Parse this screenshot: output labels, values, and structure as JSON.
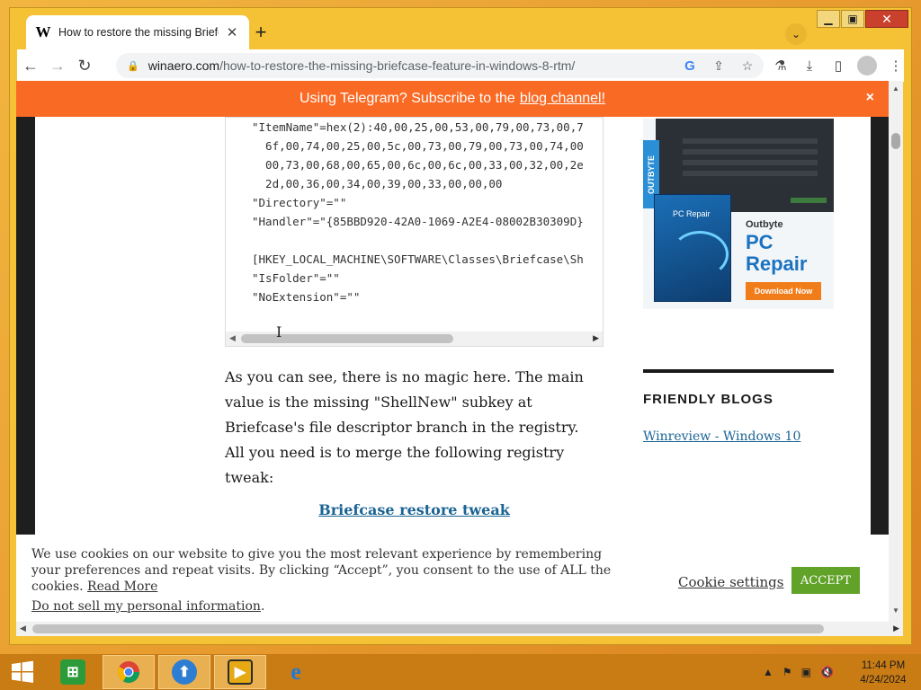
{
  "browser": {
    "tab": {
      "favicon": "W",
      "title": "How to restore the missing Briefc",
      "close": "✕"
    },
    "new_tab": "+",
    "tab_search": "⌄",
    "window_controls": {
      "minimize": "▁",
      "maximize": "▣",
      "close": "✕"
    },
    "nav": {
      "back": "←",
      "forward": "→",
      "reload": "↻"
    },
    "url": {
      "host": "winaero.com",
      "path": "/how-to-restore-the-missing-briefcase-feature-in-windows-8-rtm/"
    },
    "omni_icons": {
      "google": "G",
      "share": "⇪",
      "bookmark": "☆"
    },
    "ext_icons": {
      "lab": "⚗",
      "download": "⤓",
      "sidepanel": "▯",
      "menu": "⋮"
    }
  },
  "banner": {
    "text": "Using Telegram? Subscribe to the",
    "link": "blog channel!",
    "close": "×"
  },
  "code": {
    "lines": [
      "\"ItemName\"=hex(2):40,00,25,00,53,00,79,00,73,00,7",
      "  6f,00,74,00,25,00,5c,00,73,00,79,00,73,00,74,00",
      "  00,73,00,68,00,65,00,6c,00,6c,00,33,00,32,00,2e",
      "  2d,00,36,00,34,00,39,00,33,00,00,00",
      "\"Directory\"=\"\"",
      "\"Handler\"=\"{85BBD920-42A0-1069-A2E4-08002B30309D}",
      "",
      "[HKEY_LOCAL_MACHINE\\SOFTWARE\\Classes\\Briefcase\\Sh",
      "\"IsFolder\"=\"\"",
      "\"NoExtension\"=\"\""
    ]
  },
  "article": {
    "paragraph": "As you can see, there is no magic here. The main value is the missing \"ShellNew\" subkey at Briefcase's file descriptor branch in the registry. All you need is to merge the following registry tweak:",
    "download_link": "Briefcase restore tweak"
  },
  "ad": {
    "badge": "OUTBYTE",
    "box_label": "PC Repair",
    "brand": "Outbyte",
    "product": "PC Repair",
    "cta": "Download Now"
  },
  "sidebar": {
    "heading": "FRIENDLY BLOGS",
    "link": "Winreview - Windows 10"
  },
  "cookie": {
    "text": "We use cookies on our website to give you the most relevant experience by remembering your preferences and repeat visits. By clicking “Accept”, you consent to the use of ALL the cookies.",
    "read_more": "Read More",
    "do_not_sell": "Do not sell my personal information",
    "settings": "Cookie settings",
    "accept": "ACCEPT"
  },
  "taskbar": {
    "clock_time": "11:44 PM",
    "clock_date": "4/24/2024"
  },
  "colors": {
    "telegram_bar": "#f96a24",
    "accept_button": "#61a229",
    "link": "#1a6494",
    "taskbar": "#c97b14"
  }
}
